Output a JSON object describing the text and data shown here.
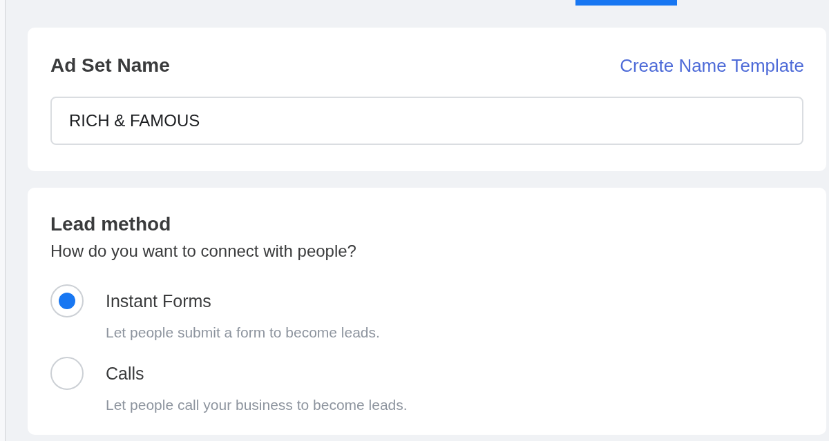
{
  "ad_set_name": {
    "title": "Ad Set Name",
    "link": "Create Name Template",
    "value": "RICH & FAMOUS"
  },
  "lead_method": {
    "title": "Lead method",
    "question": "How do you want to connect with people?",
    "options": [
      {
        "label": "Instant Forms",
        "description": "Let people submit a form to become leads.",
        "selected": true
      },
      {
        "label": "Calls",
        "description": "Let people call your business to become leads.",
        "selected": false
      }
    ]
  }
}
